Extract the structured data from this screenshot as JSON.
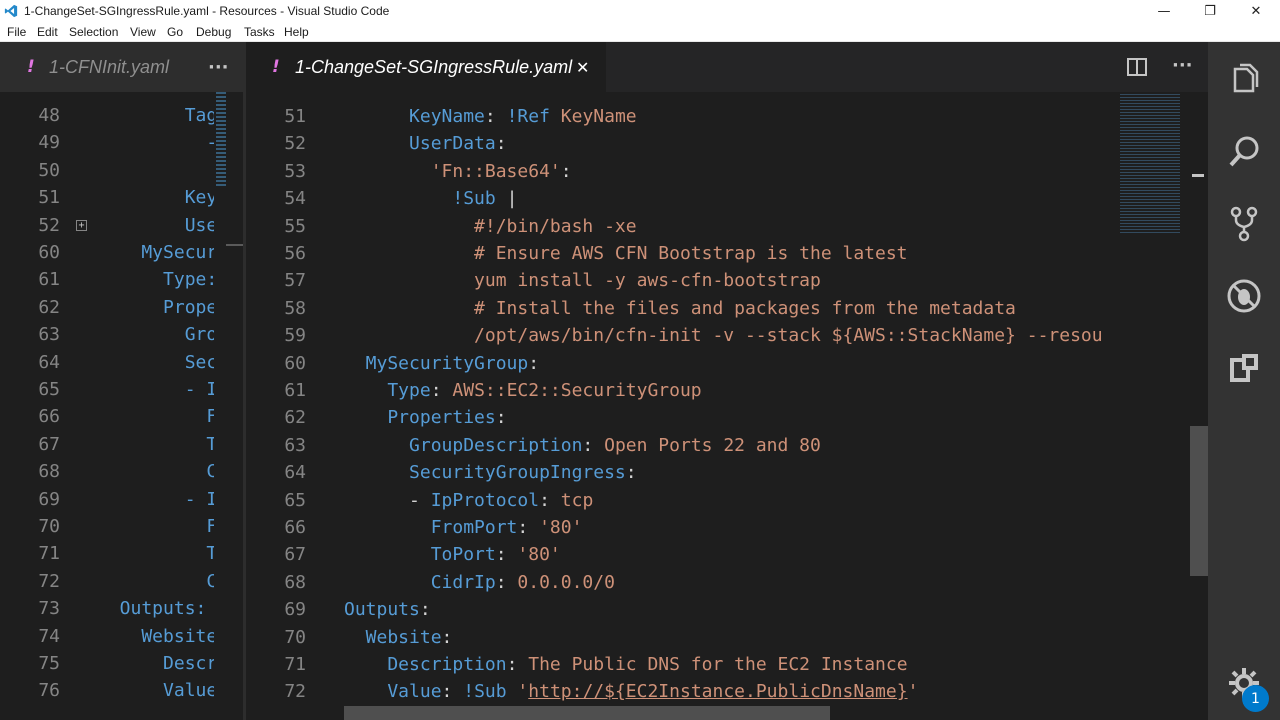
{
  "window": {
    "title": "1-ChangeSet-SGIngressRule.yaml - Resources - Visual Studio Code",
    "minimize": "—",
    "restore": "❐",
    "close": "✕"
  },
  "menu": [
    "File",
    "Edit",
    "Selection",
    "View",
    "Go",
    "Debug",
    "Tasks",
    "Help"
  ],
  "left_group": {
    "tab": {
      "modified_mark": "!",
      "label": "1-CFNInit.yaml",
      "more": "···"
    },
    "lines": [
      {
        "n": "48",
        "code": "        Tags:"
      },
      {
        "n": "49",
        "code": "          - K"
      },
      {
        "n": "50",
        "code": "            V"
      },
      {
        "n": "51",
        "code": "        KeyNa"
      },
      {
        "n": "52",
        "code": "        UserD",
        "fold": "+"
      },
      {
        "n": "60",
        "code": "    MySecurit"
      },
      {
        "n": "61",
        "code": "      Type: A"
      },
      {
        "n": "62",
        "code": "      Propert"
      },
      {
        "n": "63",
        "code": "        Group"
      },
      {
        "n": "64",
        "code": "        Secur"
      },
      {
        "n": "65",
        "code": "        - IpP"
      },
      {
        "n": "66",
        "code": "          Fro"
      },
      {
        "n": "67",
        "code": "          ToP"
      },
      {
        "n": "68",
        "code": "          Cid"
      },
      {
        "n": "69",
        "code": "        - IpP"
      },
      {
        "n": "70",
        "code": "          Fro"
      },
      {
        "n": "71",
        "code": "          ToP"
      },
      {
        "n": "72",
        "code": "          Cid"
      },
      {
        "n": "73",
        "code": "  Outputs:"
      },
      {
        "n": "74",
        "code": "    Website:"
      },
      {
        "n": "75",
        "code": "      Descrip"
      },
      {
        "n": "76",
        "code": "      Value: "
      }
    ]
  },
  "right_group": {
    "tab": {
      "modified_mark": "!",
      "label": "1-ChangeSet-SGIngressRule.yaml",
      "close": "✕"
    },
    "actions": {
      "split": "split-editor",
      "more": "···"
    },
    "lines": [
      {
        "n": "51",
        "tokens": [
          [
            "k",
            "      KeyName"
          ],
          [
            "p",
            ": "
          ],
          [
            "t",
            "!Ref "
          ],
          [
            "v",
            "KeyName"
          ]
        ]
      },
      {
        "n": "52",
        "tokens": [
          [
            "k",
            "      UserData"
          ],
          [
            "p",
            ":"
          ]
        ]
      },
      {
        "n": "53",
        "tokens": [
          [
            "v",
            "        'Fn::Base64'"
          ],
          [
            "p",
            ":"
          ]
        ]
      },
      {
        "n": "54",
        "tokens": [
          [
            "t",
            "          !Sub "
          ],
          [
            "p",
            "|"
          ]
        ]
      },
      {
        "n": "55",
        "tokens": [
          [
            "v",
            "            #!/bin/bash -xe"
          ]
        ]
      },
      {
        "n": "56",
        "tokens": [
          [
            "v",
            "            # Ensure AWS CFN Bootstrap is the latest"
          ]
        ]
      },
      {
        "n": "57",
        "tokens": [
          [
            "v",
            "            yum install -y aws-cfn-bootstrap"
          ]
        ]
      },
      {
        "n": "58",
        "tokens": [
          [
            "v",
            "            # Install the files and packages from the metadata"
          ]
        ]
      },
      {
        "n": "59",
        "tokens": [
          [
            "v",
            "            /opt/aws/bin/cfn-init -v --stack ${AWS::StackName} --resou"
          ]
        ]
      },
      {
        "n": "60",
        "tokens": [
          [
            "k",
            "  MySecurityGroup"
          ],
          [
            "p",
            ":"
          ]
        ]
      },
      {
        "n": "61",
        "tokens": [
          [
            "k",
            "    Type"
          ],
          [
            "p",
            ": "
          ],
          [
            "v",
            "AWS::EC2::SecurityGroup"
          ]
        ]
      },
      {
        "n": "62",
        "tokens": [
          [
            "k",
            "    Properties"
          ],
          [
            "p",
            ":"
          ]
        ]
      },
      {
        "n": "63",
        "tokens": [
          [
            "k",
            "      GroupDescription"
          ],
          [
            "p",
            ": "
          ],
          [
            "v",
            "Open Ports 22 and 80"
          ]
        ]
      },
      {
        "n": "64",
        "tokens": [
          [
            "k",
            "      SecurityGroupIngress"
          ],
          [
            "p",
            ":"
          ]
        ]
      },
      {
        "n": "65",
        "tokens": [
          [
            "p",
            "      - "
          ],
          [
            "k",
            "IpProtocol"
          ],
          [
            "p",
            ": "
          ],
          [
            "v",
            "tcp"
          ]
        ]
      },
      {
        "n": "66",
        "tokens": [
          [
            "k",
            "        FromPort"
          ],
          [
            "p",
            ": "
          ],
          [
            "v",
            "'80'"
          ]
        ]
      },
      {
        "n": "67",
        "tokens": [
          [
            "k",
            "        ToPort"
          ],
          [
            "p",
            ": "
          ],
          [
            "v",
            "'80'"
          ]
        ]
      },
      {
        "n": "68",
        "tokens": [
          [
            "k",
            "        CidrIp"
          ],
          [
            "p",
            ": "
          ],
          [
            "v",
            "0.0.0.0/0"
          ]
        ]
      },
      {
        "n": "69",
        "tokens": [
          [
            "k",
            "Outputs"
          ],
          [
            "p",
            ":"
          ]
        ]
      },
      {
        "n": "70",
        "tokens": [
          [
            "k",
            "  Website"
          ],
          [
            "p",
            ":"
          ]
        ]
      },
      {
        "n": "71",
        "tokens": [
          [
            "k",
            "    Description"
          ],
          [
            "p",
            ": "
          ],
          [
            "v",
            "The Public DNS for the EC2 Instance"
          ]
        ]
      },
      {
        "n": "72",
        "tokens": [
          [
            "k",
            "    Value"
          ],
          [
            "p",
            ": "
          ],
          [
            "t",
            "!Sub "
          ],
          [
            "v",
            "'"
          ],
          [
            "u",
            "http://${EC2Instance.PublicDnsName}"
          ],
          [
            "v",
            "'"
          ]
        ]
      }
    ]
  },
  "activity_bar": {
    "items": [
      "explorer-icon",
      "search-icon",
      "source-control-icon",
      "debug-icon",
      "extensions-icon"
    ],
    "settings": "gear-icon",
    "badge": "1"
  }
}
